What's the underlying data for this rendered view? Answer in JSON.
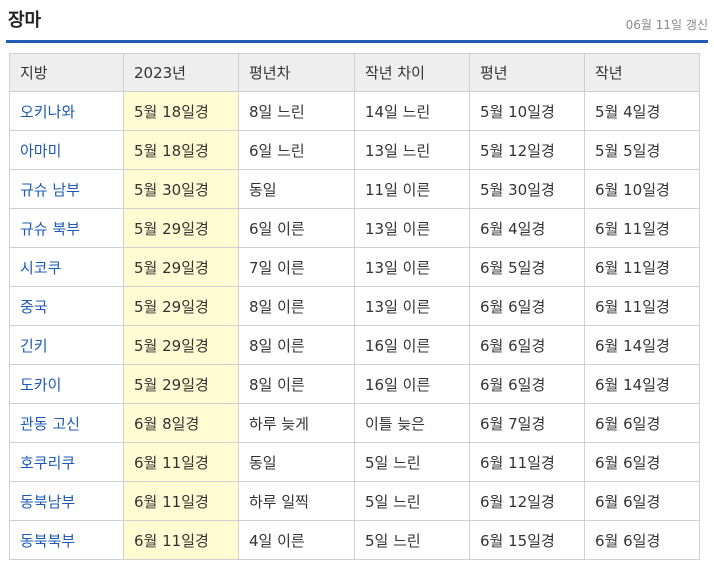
{
  "header": {
    "title": "장마",
    "updated": "06월 11일 갱신"
  },
  "table": {
    "columns": [
      "지방",
      "2023년",
      "평년차",
      "작년 차이",
      "평년",
      "작년"
    ],
    "rows": [
      [
        "오키나와",
        "5월 18일경",
        "8일 느린",
        "14일 느린",
        "5월 10일경",
        "5월 4일경"
      ],
      [
        "아마미",
        "5월 18일경",
        "6일 느린",
        "13일 느린",
        "5월 12일경",
        "5월 5일경"
      ],
      [
        "규슈 남부",
        "5월 30일경",
        "동일",
        "11일 이른",
        "5월 30일경",
        "6월 10일경"
      ],
      [
        "규슈 북부",
        "5월 29일경",
        "6일 이른",
        "13일 이른",
        "6월 4일경",
        "6월 11일경"
      ],
      [
        "시코쿠",
        "5월 29일경",
        "7일 이른",
        "13일 이른",
        "6월 5일경",
        "6월 11일경"
      ],
      [
        "중국",
        "5월 29일경",
        "8일 이른",
        "13일 이른",
        "6월 6일경",
        "6월 11일경"
      ],
      [
        "긴키",
        "5월 29일경",
        "8일 이른",
        "16일 이른",
        "6월 6일경",
        "6월 14일경"
      ],
      [
        "도카이",
        "5월 29일경",
        "8일 이른",
        "16일 이른",
        "6월 6일경",
        "6월 14일경"
      ],
      [
        "관동 고신",
        "6월 8일경",
        "하루 늦게",
        "이틀 늦은",
        "6월 7일경",
        "6월 6일경"
      ],
      [
        "호쿠리쿠",
        "6월 11일경",
        "동일",
        "5일 느린",
        "6월 11일경",
        "6월 6일경"
      ],
      [
        "동북남부",
        "6월 11일경",
        "하루 일찍",
        "5일 느린",
        "6월 12일경",
        "6월 6일경"
      ],
      [
        "동북북부",
        "6월 11일경",
        "4일 이른",
        "5일 느린",
        "6월 15일경",
        "6월 6일경"
      ]
    ]
  },
  "colors": {
    "accent": "#1f5bb5",
    "highlight": "#fffbd2",
    "header_bg": "#eeeeee"
  }
}
